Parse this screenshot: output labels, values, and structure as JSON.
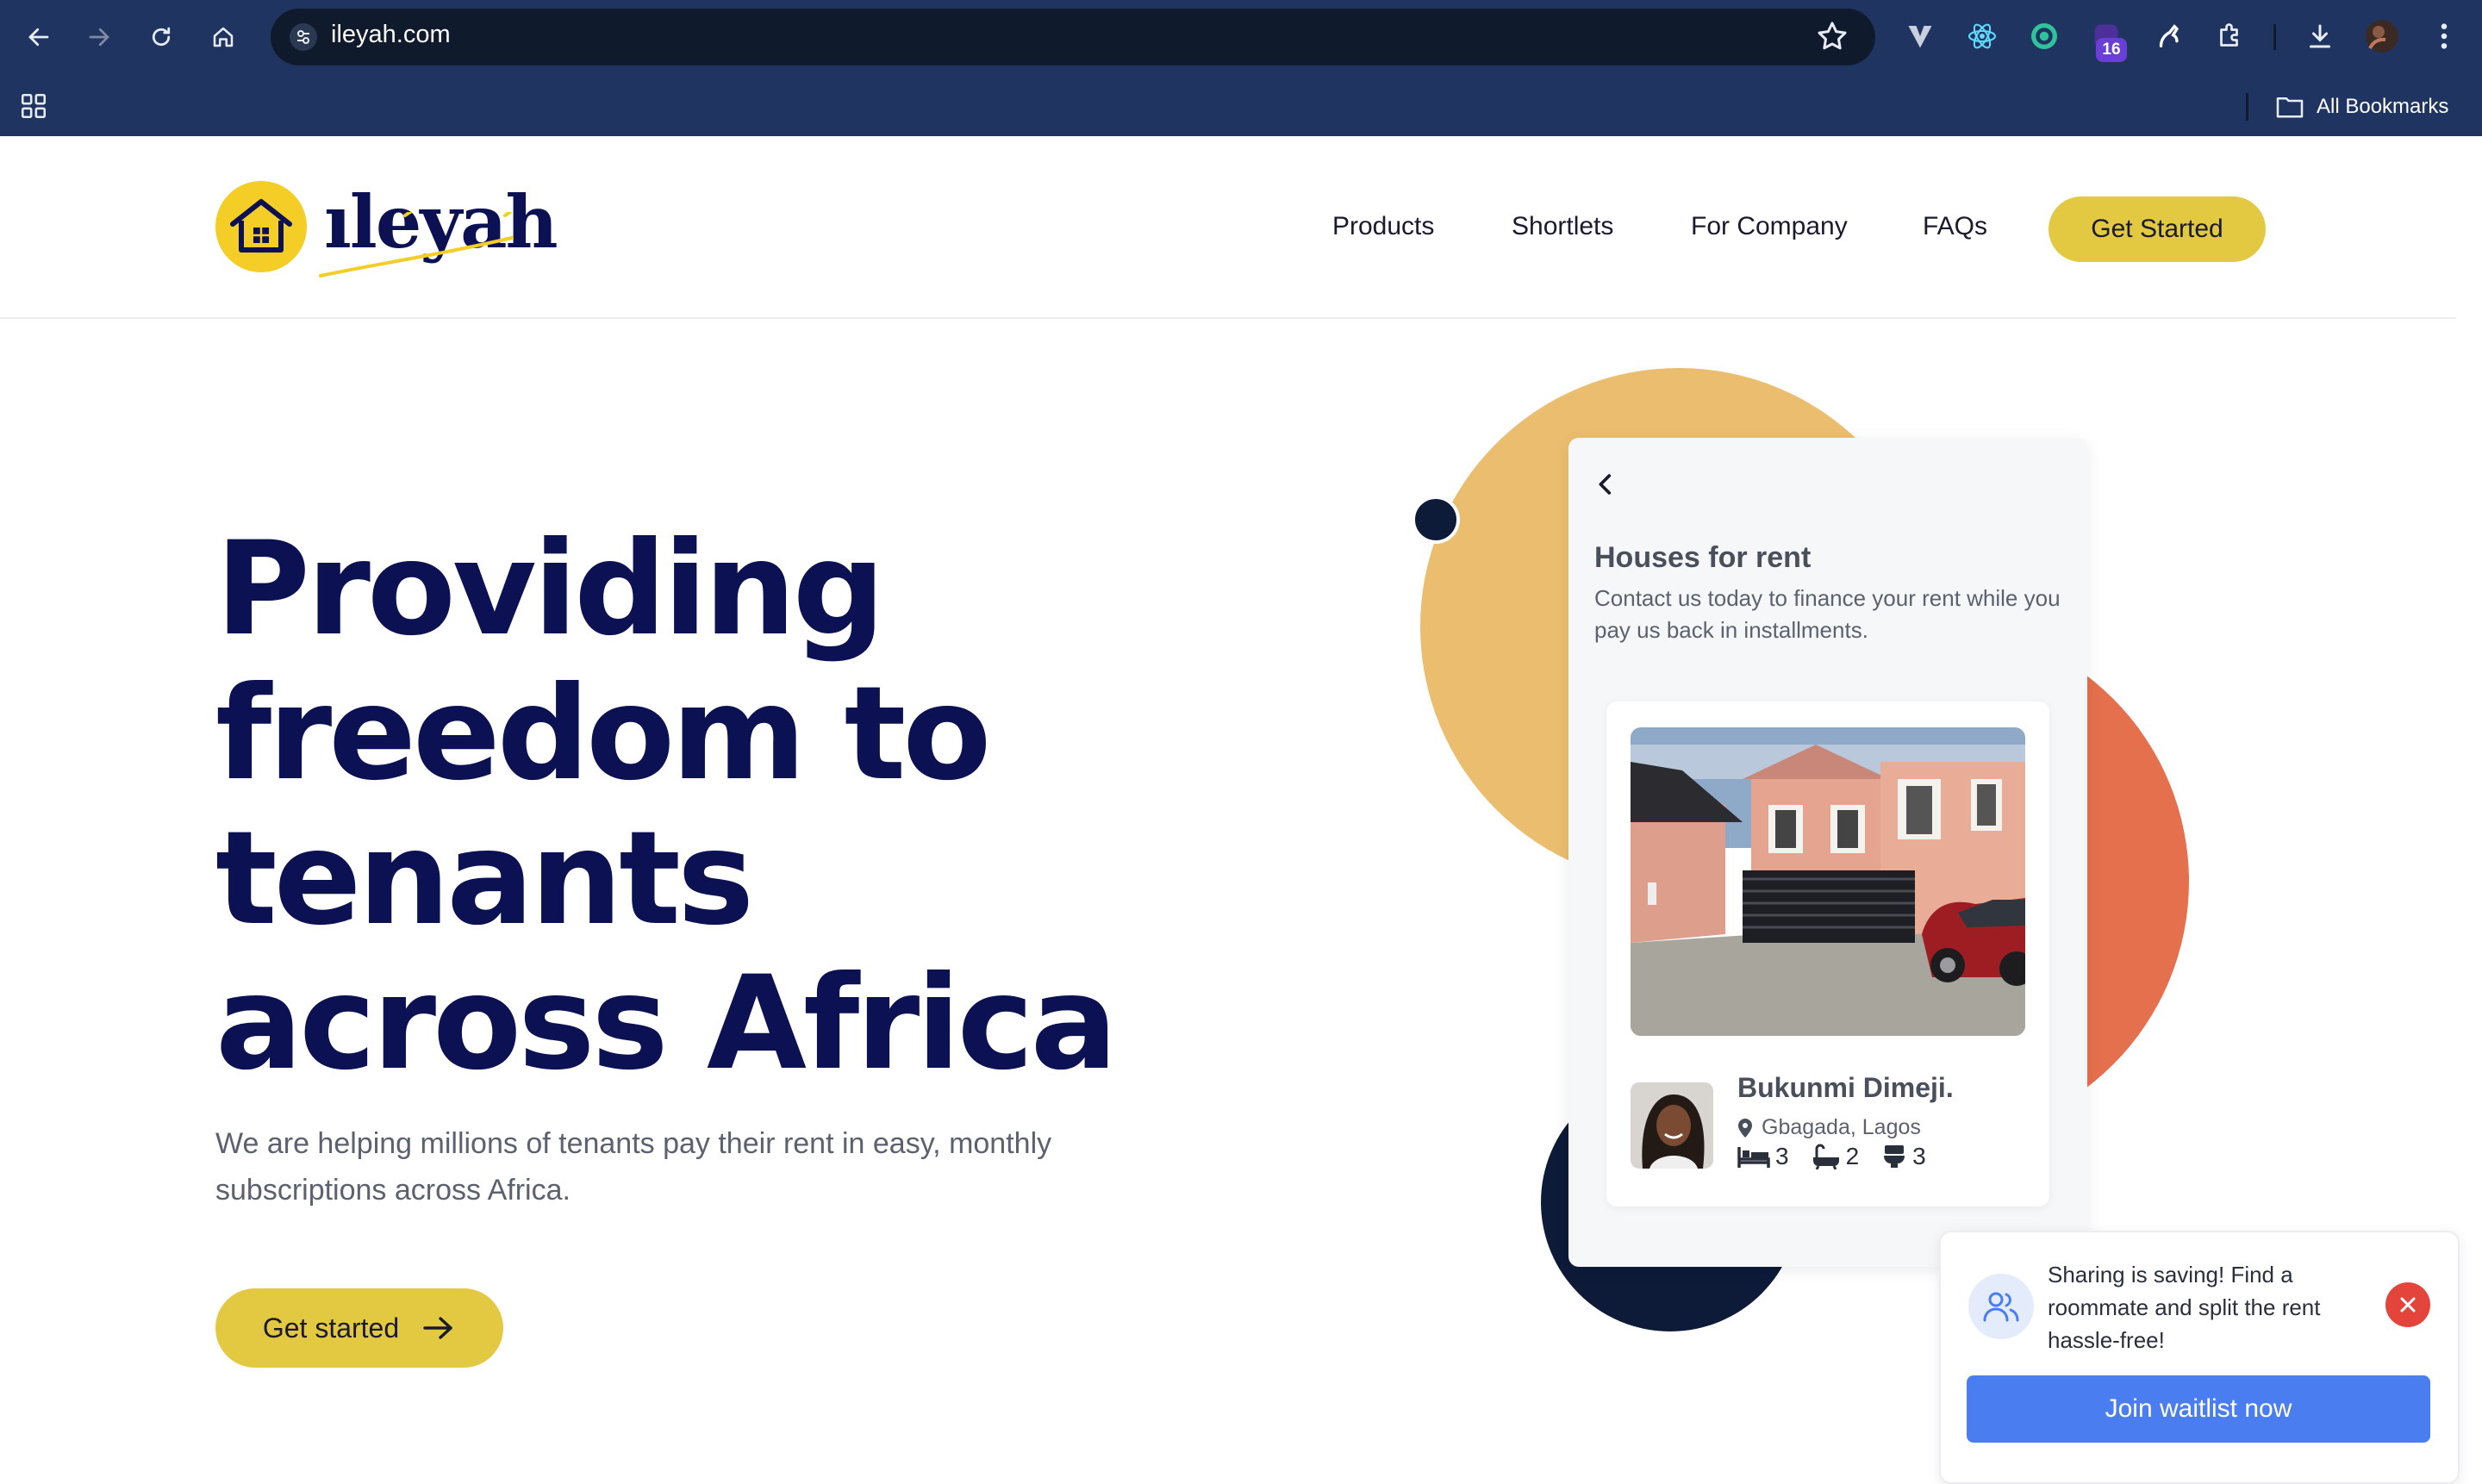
{
  "browser": {
    "url": "ileyah.com",
    "extension_badge": "16",
    "bookmarks_label": "All Bookmarks"
  },
  "nav": {
    "logo_text": "ıleyah",
    "links": [
      "Products",
      "Shortlets",
      "For Company",
      "FAQs"
    ],
    "cta": "Get Started"
  },
  "hero": {
    "title_lines": [
      "Providing",
      "freedom to",
      "tenants",
      "across Africa"
    ],
    "subtitle": "We are helping millions of tenants pay their rent in easy, monthly subscriptions across Africa.",
    "cta": "Get started"
  },
  "card": {
    "title": "Houses for rent",
    "description": "Contact us today to finance your rent while you pay us back in installments.",
    "agent_name": "Bukunmi Dimeji.",
    "location": "Gbagada, Lagos",
    "beds": "3",
    "baths": "2",
    "toilets": "3"
  },
  "toast": {
    "message": "Sharing is saving! Find a roommate and split the rent hassle-free!",
    "cta": "Join waitlist now"
  },
  "colors": {
    "chrome": "#1f3461",
    "brand_navy": "#0b1152",
    "brand_yellow": "#e3c841",
    "accent_orange": "#e5704d",
    "accent_gold": "#ebbd6f",
    "cta_blue": "#4a7ef0",
    "close_red": "#e3443c"
  }
}
